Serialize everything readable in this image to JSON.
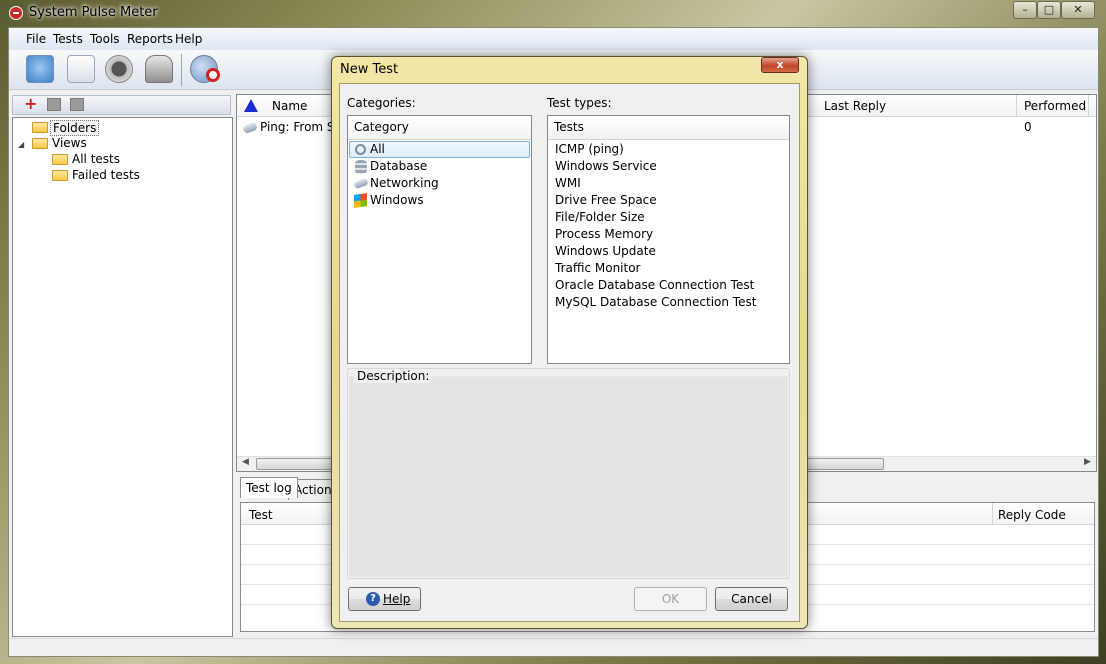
{
  "window": {
    "title": "System Pulse Meter",
    "minimize": "–",
    "maximize": "□",
    "close": "✕"
  },
  "menu": [
    "File",
    "Tests",
    "Tools",
    "Reports",
    "Help"
  ],
  "tree": {
    "folders": "Folders",
    "views": "Views",
    "all_tests": "All tests",
    "failed_tests": "Failed tests"
  },
  "list": {
    "columns": [
      "Name",
      "Last Reply",
      "Performed"
    ],
    "rows": [
      {
        "name": "Ping: From Sys",
        "performed": "0"
      }
    ]
  },
  "log": {
    "tabs": [
      "Test log",
      "Action lo"
    ],
    "columns": [
      "Test",
      "Reply Code"
    ]
  },
  "dialog": {
    "title": "New Test",
    "close": "x",
    "categories_label": "Categories:",
    "category_header": "Category",
    "categories": [
      "All",
      "Database",
      "Networking",
      "Windows"
    ],
    "test_types_label": "Test types:",
    "tests_header": "Tests",
    "tests": [
      "ICMP (ping)",
      "Windows Service",
      "WMI",
      "Drive Free Space",
      "File/Folder Size",
      "Process Memory",
      "Windows Update",
      "Traffic Monitor",
      "Oracle Database Connection Test",
      "MySQL Database Connection Test"
    ],
    "description_label": "Description:",
    "help_button": "Help",
    "ok_button": "OK",
    "cancel_button": "Cancel"
  }
}
